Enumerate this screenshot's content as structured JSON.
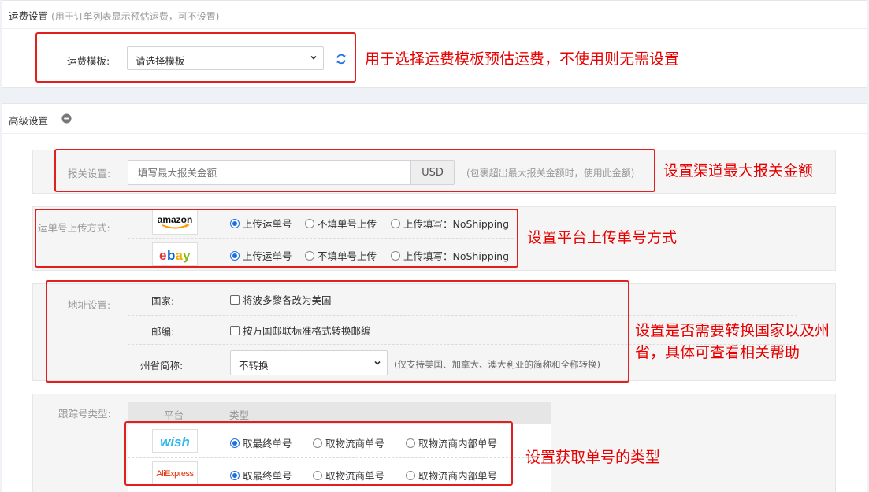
{
  "shipping": {
    "title": "运费设置",
    "subtitle": "(用于订单列表显示预估运费，可不设置)",
    "template_label": "运费模板:",
    "template_value": "请选择模板",
    "note": "用于选择运费模板预估运费，不使用则无需设置"
  },
  "advanced": {
    "title": "高级设置",
    "customs": {
      "label": "报关设置:",
      "placeholder": "填写最大报关金额",
      "currency": "USD",
      "hint": "(包裹超出最大报关金额时，使用此金额)",
      "note": "设置渠道最大报关金额"
    },
    "upload": {
      "label": "运单号上传方式:",
      "note": "设置平台上传单号方式",
      "platforms": [
        {
          "logo": "amazon",
          "selected": 0,
          "options": [
            "上传运单号",
            "不填单号上传",
            "上传填写：NoShipping"
          ]
        },
        {
          "logo": "ebay",
          "selected": 0,
          "options": [
            "上传运单号",
            "不填单号上传",
            "上传填写：NoShipping"
          ]
        }
      ]
    },
    "address": {
      "label": "地址设置:",
      "country_label": "国家:",
      "country_option": "将波多黎各改为美国",
      "zip_label": "邮编:",
      "zip_option": "按万国邮联标准格式转换邮编",
      "state_label": "州省简称:",
      "state_value": "不转换",
      "state_hint": "(仅支持美国、加拿大、澳大利亚的简称和全称转换)",
      "note_line1": "设置是否需要转换国家以及州",
      "note_line2": "省，具体可查看相关帮助"
    },
    "tracking": {
      "label": "跟踪号类型:",
      "col_platform": "平台",
      "col_type": "类型",
      "note": "设置获取单号的类型",
      "platforms": [
        {
          "logo": "wish",
          "selected": 0,
          "options": [
            "取最终单号",
            "取物流商单号",
            "取物流商内部单号"
          ]
        },
        {
          "logo": "AliExpress",
          "selected": 0,
          "options": [
            "取最终单号",
            "取物流商单号",
            "取物流商内部单号"
          ]
        }
      ]
    }
  },
  "colors": {
    "annotation": "#e60000",
    "radio_accent": "#1e6fe0",
    "wish_blue": "#2fb7ec",
    "amazon_orange": "#ff9900",
    "ebay_red": "#e53238",
    "ebay_blue": "#0064d2",
    "ebay_yellow": "#f5af02",
    "ebay_green": "#86b817",
    "aliexpress_red": "#e62e04"
  }
}
